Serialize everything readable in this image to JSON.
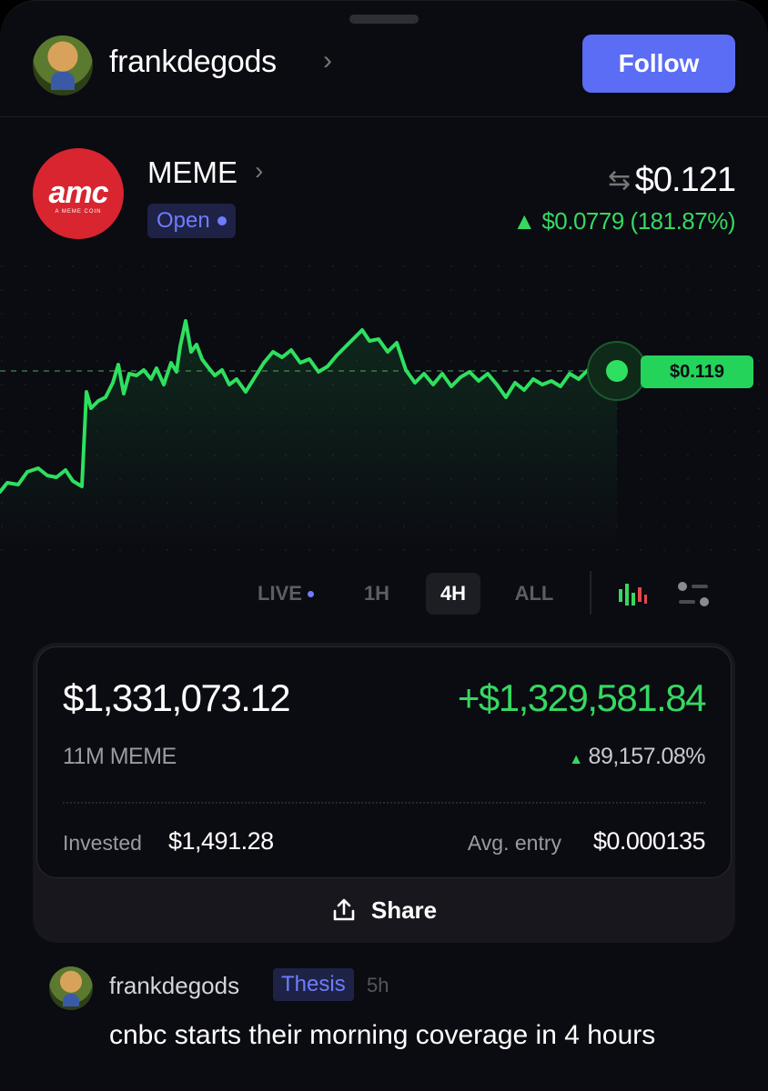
{
  "header": {
    "username": "frankdegods",
    "follow_label": "Follow",
    "avatar_icon": "avatar-image"
  },
  "coin": {
    "logo_text": "amc",
    "logo_tagline": "A MEME COIN",
    "name": "MEME",
    "status": "Open",
    "price": "$0.121",
    "change": "▲ $0.0779 (181.87%)",
    "current_tag": "$0.119",
    "colors": {
      "up": "#36d860",
      "logo_bg": "#d8252f",
      "accent": "#5b6cf5"
    }
  },
  "timeframes": {
    "items": [
      "LIVE",
      "1H",
      "4H",
      "ALL"
    ],
    "active": "4H",
    "chart_type_icon": "candlestick-icon",
    "settings_icon": "chart-settings-icon"
  },
  "position": {
    "value": "$1,331,073.12",
    "pnl": "+$1,329,581.84",
    "holdings": "11M MEME",
    "pnl_pct": "89,157.08%",
    "invested_label": "Invested",
    "invested_value": "$1,491.28",
    "entry_label": "Avg. entry",
    "entry_value": "$0.000135",
    "share_label": "Share"
  },
  "comment": {
    "username": "frankdegods",
    "badge": "Thesis",
    "time": "5h",
    "text": "cnbc starts their morning coverage in 4 hours"
  }
}
